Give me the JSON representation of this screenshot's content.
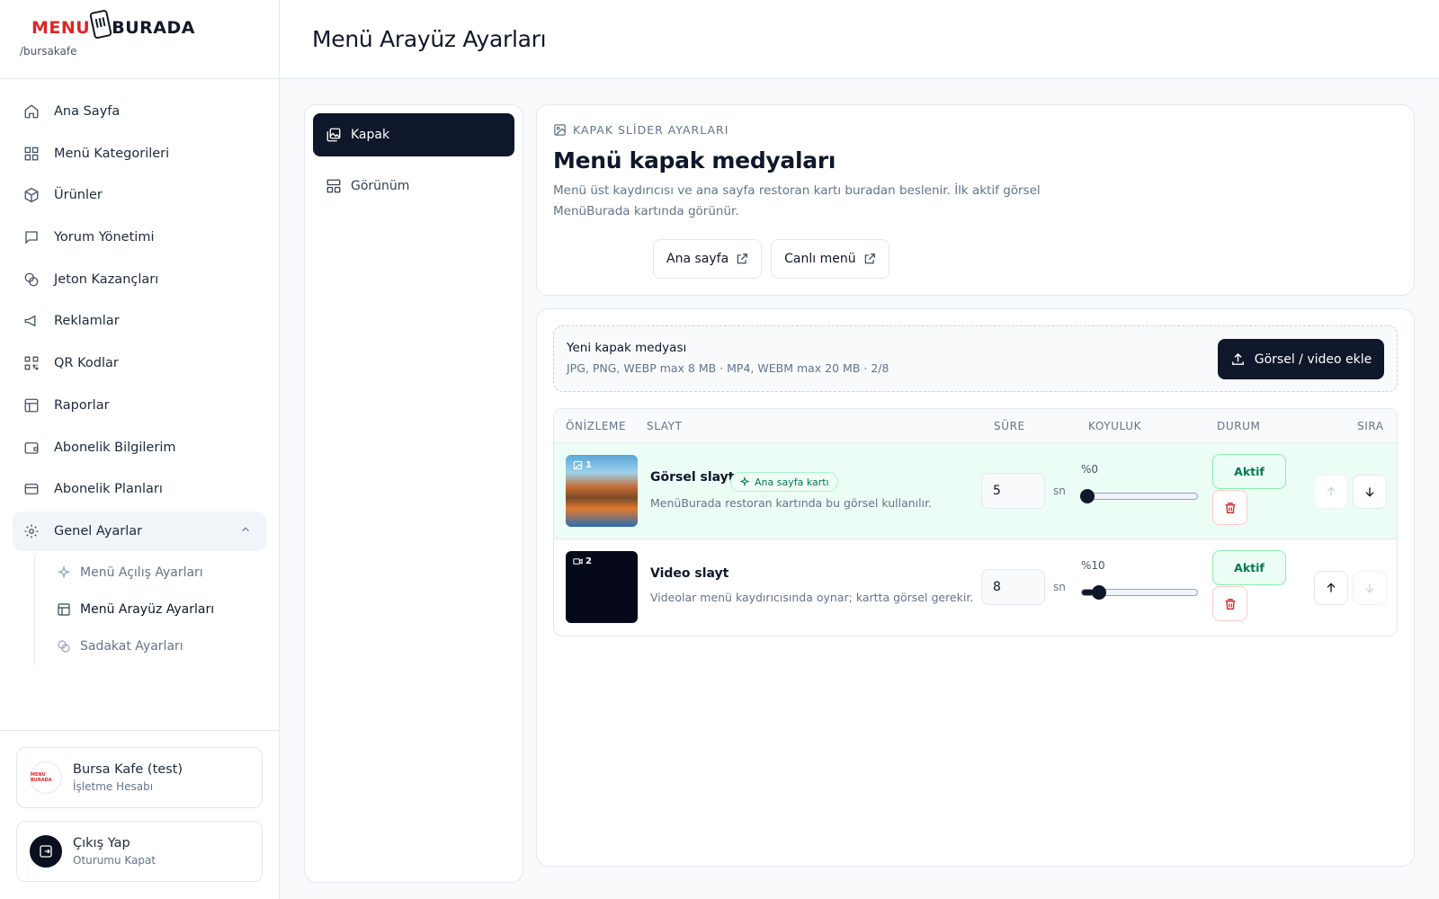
{
  "brand": {
    "logo_left": "MENU",
    "logo_right": "BURADA",
    "slug": "/bursakafe"
  },
  "sidebar": {
    "items": [
      {
        "label": "Ana Sayfa",
        "icon": "home-icon"
      },
      {
        "label": "Menü Kategorileri",
        "icon": "grid-icon"
      },
      {
        "label": "Ürünler",
        "icon": "package-icon"
      },
      {
        "label": "Yorum Yönetimi",
        "icon": "message-icon"
      },
      {
        "label": "Jeton Kazançları",
        "icon": "coins-icon"
      },
      {
        "label": "Reklamlar",
        "icon": "megaphone-icon"
      },
      {
        "label": "QR Kodlar",
        "icon": "qr-icon"
      },
      {
        "label": "Raporlar",
        "icon": "report-icon"
      },
      {
        "label": "Abonelik Bilgilerim",
        "icon": "wallet-icon"
      },
      {
        "label": "Abonelik Planları",
        "icon": "card-icon"
      },
      {
        "label": "Genel Ayarlar",
        "icon": "gear-icon"
      }
    ],
    "subitems": [
      {
        "label": "Menü Açılış Ayarları",
        "icon": "sparkles-icon"
      },
      {
        "label": "Menü Arayüz Ayarları",
        "icon": "layout-icon"
      },
      {
        "label": "Sadakat Ayarları",
        "icon": "coins-icon"
      }
    ],
    "account": {
      "name": "Bursa Kafe (test)",
      "sub": "İşletme Hesabı",
      "avatar_text": "MENU BURADA"
    },
    "logout": {
      "name": "Çıkış Yap",
      "sub": "Oturumu Kapat"
    }
  },
  "header": {
    "title": "Menü Arayüz Ayarları"
  },
  "tabs": [
    {
      "label": "Kapak",
      "icon": "images-icon"
    },
    {
      "label": "Görünüm",
      "icon": "layout-icon"
    }
  ],
  "info": {
    "eyebrow": "KAPAK SLİDER AYARLARI",
    "title": "Menü kapak medyaları",
    "desc": "Menü üst kaydırıcısı ve ana sayfa restoran kartı buradan beslenir. İlk aktif görsel MenüBurada kartında görünür.",
    "links": [
      "Ana sayfa",
      "Canlı menü"
    ]
  },
  "upload": {
    "title": "Yeni kapak medyası",
    "sub": "JPG, PNG, WEBP max 8 MB · MP4, WEBM max 20 MB · 2/8",
    "button": "Görsel / video ekle"
  },
  "table": {
    "headers": [
      "ÖNİZLEME",
      "SLAYT",
      "SÜRE",
      "KOYULUK",
      "DURUM",
      "SIRA"
    ],
    "rows": [
      {
        "index": "1",
        "title": "Görsel slayt",
        "tag": "Ana sayfa kartı",
        "sub": "MenüBurada restoran kartında bu görsel kullanılır.",
        "duration": "5",
        "unit": "sn",
        "darkness_label": "%0",
        "darkness": 0,
        "status": "Aktif"
      },
      {
        "index": "2",
        "title": "Video slayt",
        "tag": "",
        "sub": "Videolar menü kaydırıcısında oynar; kartta görsel gerekir.",
        "duration": "8",
        "unit": "sn",
        "darkness_label": "%10",
        "darkness": 10,
        "status": "Aktif"
      }
    ]
  },
  "colors": {
    "primary": "#0f172a",
    "brand_red": "#dc2626",
    "success": "#047857",
    "row_highlight": "#ecfdf5"
  }
}
